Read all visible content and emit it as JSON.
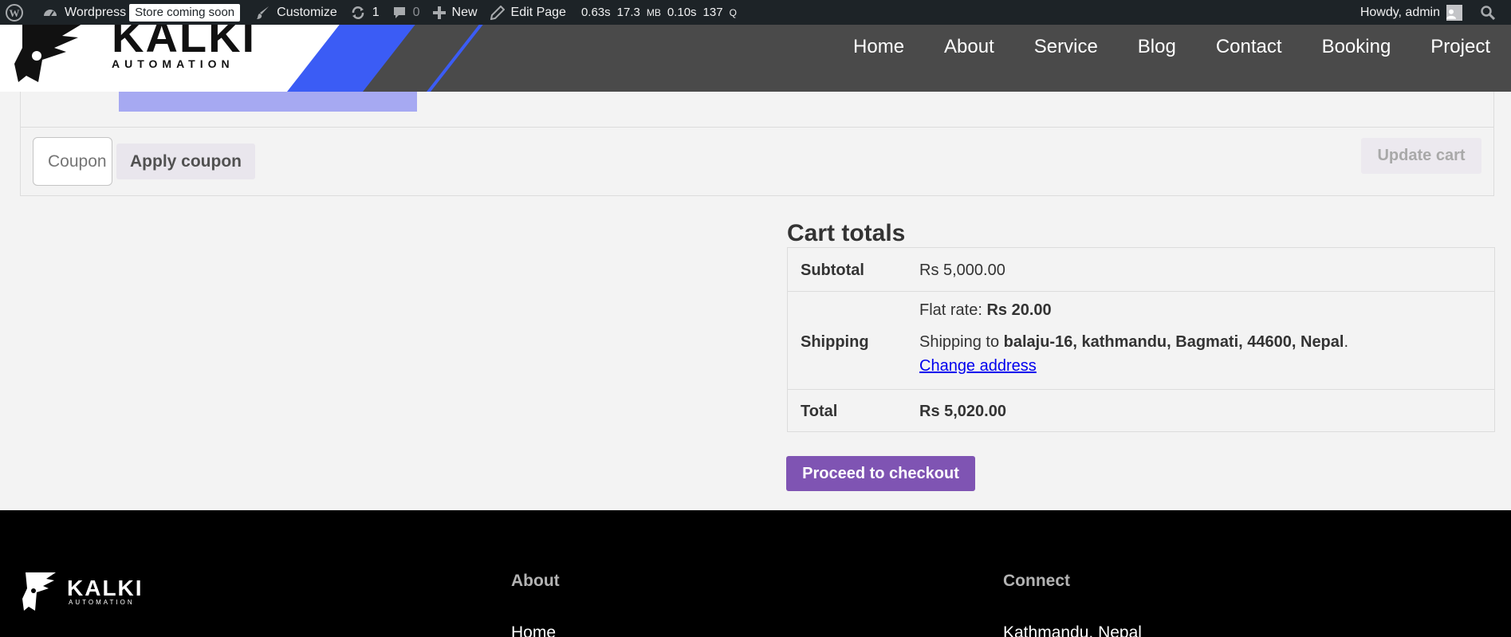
{
  "admin_bar": {
    "site_name": "Wordpress",
    "store_badge": "Store coming soon",
    "customize": "Customize",
    "updates_count": "1",
    "comments_count": "0",
    "new_label": "New",
    "edit_page": "Edit Page",
    "stats": {
      "time": "0.63s",
      "memory": "17.3",
      "memory_unit": "MB",
      "query_time": "0.10s",
      "queries": "137",
      "queries_unit": "Q"
    },
    "greeting": "Howdy, admin"
  },
  "header": {
    "logo_text": "KALKI",
    "logo_sub": "AUTOMATION",
    "nav": [
      "Home",
      "About",
      "Service",
      "Blog",
      "Contact",
      "Booking",
      "Project"
    ]
  },
  "cart": {
    "coupon_placeholder": "Coupon code",
    "apply_coupon": "Apply coupon",
    "update_cart": "Update cart"
  },
  "totals": {
    "title": "Cart totals",
    "subtotal_label": "Subtotal",
    "subtotal_value": "Rs 5,000.00",
    "shipping_label": "Shipping",
    "flat_rate_label": "Flat rate: ",
    "flat_rate_value": "Rs 20.00",
    "shipping_to_prefix": "Shipping to ",
    "shipping_address": "balaju-16, kathmandu, Bagmati, 44600, Nepal",
    "shipping_to_suffix": ".",
    "change_address": "Change address",
    "total_label": "Total",
    "total_value": "Rs 5,020.00",
    "checkout": "Proceed to checkout"
  },
  "footer": {
    "logo_text": "KALKI",
    "logo_sub": "AUTOMATION",
    "col1_heading": "About",
    "col1_item": "Home",
    "col2_heading": "Connect",
    "col2_item": "Kathmandu, Nepal"
  },
  "colors": {
    "admin_bar_bg": "#1d2327",
    "header_bg": "#4a4a4a",
    "accent_blue": "#3b5cf5",
    "checkout_purple": "#7f54b3",
    "footer_bg": "#000000"
  }
}
